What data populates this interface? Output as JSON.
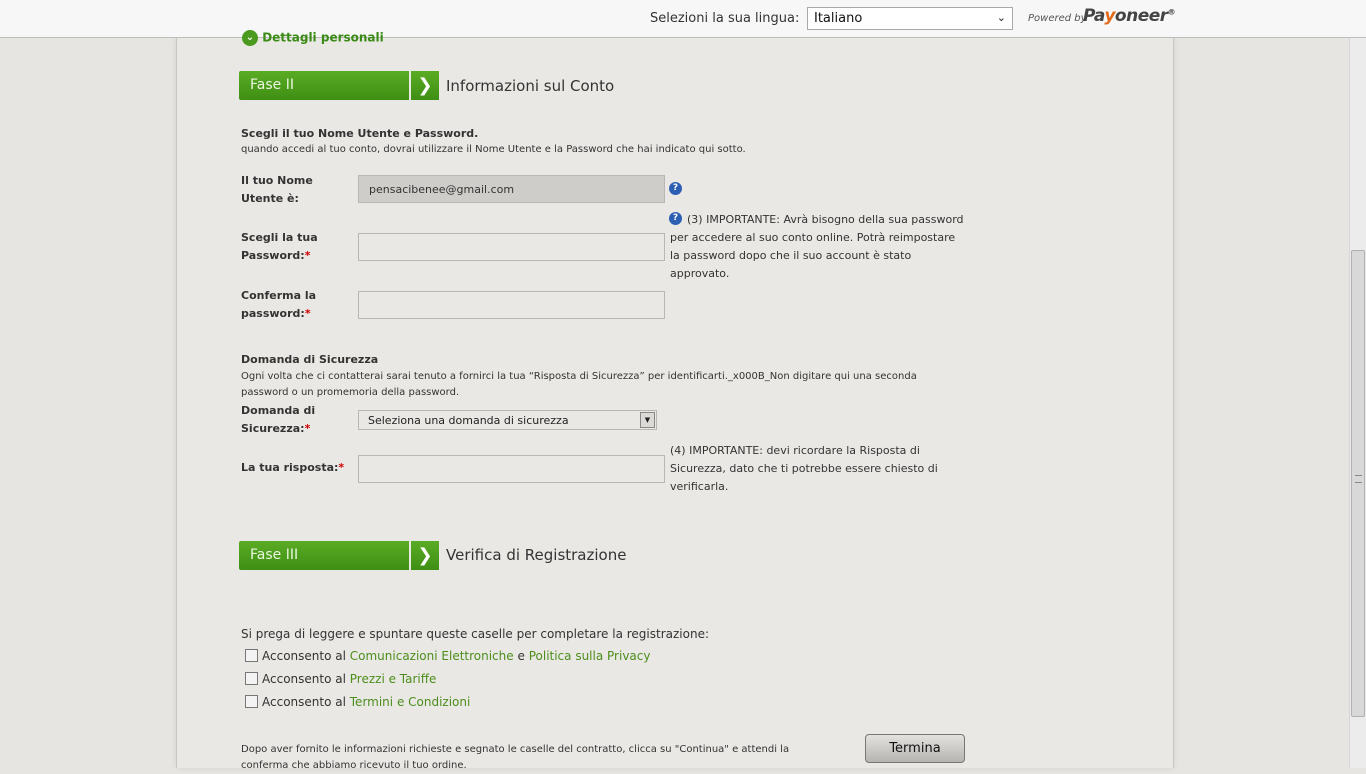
{
  "topbar": {
    "language_label": "Selezioni la sua lingua:",
    "language_value": "Italiano",
    "powered_by": "Powered by",
    "logo_pa": "Pa",
    "logo_o": "y",
    "logo_rest": "oneer"
  },
  "personal_link": "Dettagli personali",
  "phase2": {
    "label": "Fase II",
    "title": "Informazioni sul Conto"
  },
  "account": {
    "heading": "Scegli il tuo Nome Utente e Password.",
    "subtext": "quando accedi al tuo conto, dovrai utilizzare il Nome Utente e la Password che hai indicato qui sotto.",
    "username_label": "Il tuo Nome Utente è:",
    "username_value": "pensacibenee@gmail.com",
    "password_label": "Scegli la tua Password:",
    "confirm_label": "Conferma la password:",
    "password_note": "(3) IMPORTANTE: Avrà bisogno della sua password per accedere al suo conto online. Potrà reimpostare la password dopo che il suo account è stato approvato."
  },
  "security": {
    "heading": "Domanda di Sicurezza",
    "subtext": "Ogni volta che ci contatterai sarai tenuto a fornirci la tua “Risposta di Sicurezza” per identificarti._x000B_Non digitare qui una seconda password o un promemoria della password.",
    "question_label": "Domanda di Sicurezza:",
    "question_value": "Seleziona una domanda di sicurezza",
    "answer_label": "La tua risposta:",
    "answer_note": "(4) IMPORTANTE: devi ricordare la Risposta di Sicurezza, dato che ti potrebbe essere chiesto di verificarla."
  },
  "phase3": {
    "label": "Fase III",
    "title": "Verifica di Registrazione"
  },
  "verification": {
    "intro": "Si prega di leggere e spuntare queste caselle per completare la registrazione:",
    "consent_prefix": "Acconsento al",
    "row1_link1": "Comunicazioni Elettroniche",
    "row1_joiner": "e",
    "row1_link2": "Politica sulla Privacy",
    "row2_link": "Prezzi e Tariffe",
    "row3_link": "Termini e Condizioni",
    "footer": "Dopo aver fornito le informazioni richieste e segnato le caselle del contratto, clicca su \"Continua\" e attendi la conferma che abbiamo ricevuto il tuo ordine.",
    "submit_label": "Termina"
  },
  "required_mark": "*",
  "icons": {
    "help": "question-circle-icon",
    "arrow": "chevron-right-icon"
  },
  "colors": {
    "phase_green": "#4c9b1c",
    "link_green": "#4c8e1c",
    "required_red": "#cc0000"
  }
}
